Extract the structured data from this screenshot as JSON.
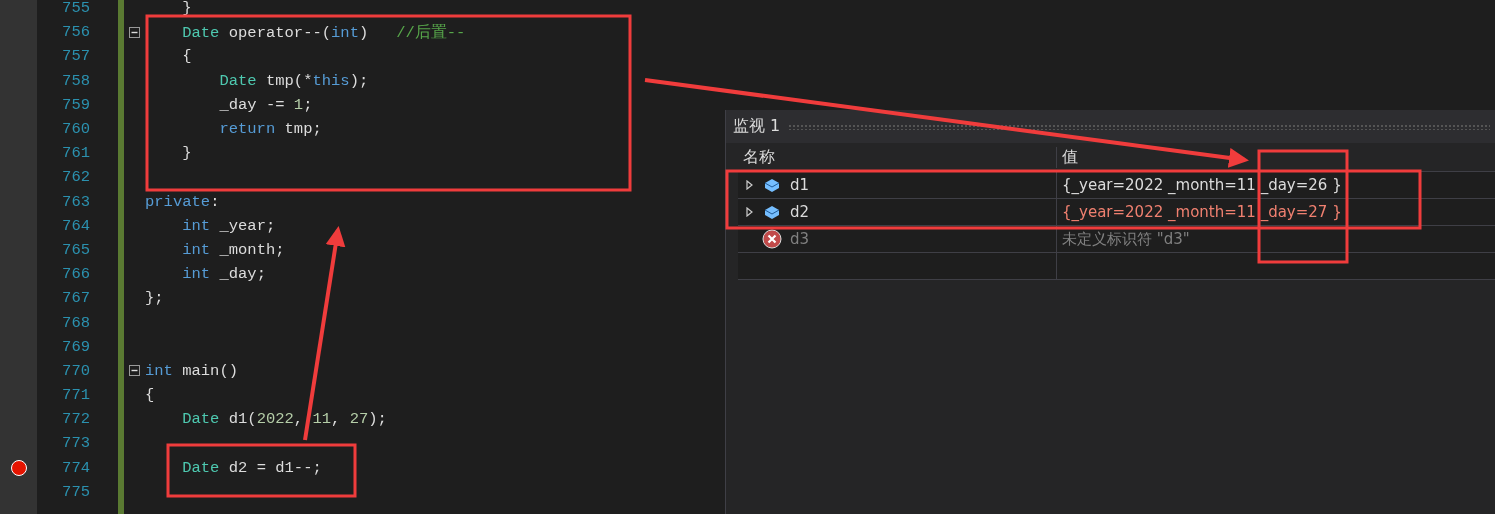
{
  "editor": {
    "lines": [
      {
        "number": "755",
        "breakpoint": false,
        "fold": false,
        "tokens": [
          {
            "kind": "plain",
            "text": "    }"
          }
        ]
      },
      {
        "number": "756",
        "breakpoint": false,
        "fold": true,
        "tokens": [
          {
            "kind": "type",
            "text": "    Date"
          },
          {
            "kind": "plain",
            "text": " operator--("
          },
          {
            "kind": "keyword",
            "text": "int"
          },
          {
            "kind": "plain",
            "text": ")   "
          },
          {
            "kind": "comment",
            "text": "//后置--"
          }
        ]
      },
      {
        "number": "757",
        "breakpoint": false,
        "fold": false,
        "tokens": [
          {
            "kind": "plain",
            "text": "    {"
          }
        ]
      },
      {
        "number": "758",
        "breakpoint": false,
        "fold": false,
        "tokens": [
          {
            "kind": "type",
            "text": "        Date"
          },
          {
            "kind": "plain",
            "text": " tmp(*"
          },
          {
            "kind": "keyword",
            "text": "this"
          },
          {
            "kind": "plain",
            "text": ");"
          }
        ]
      },
      {
        "number": "759",
        "breakpoint": false,
        "fold": false,
        "tokens": [
          {
            "kind": "plain",
            "text": "        _day -= "
          },
          {
            "kind": "number",
            "text": "1"
          },
          {
            "kind": "plain",
            "text": ";"
          }
        ]
      },
      {
        "number": "760",
        "breakpoint": false,
        "fold": false,
        "tokens": [
          {
            "kind": "keyword",
            "text": "        return"
          },
          {
            "kind": "plain",
            "text": " tmp;"
          }
        ]
      },
      {
        "number": "761",
        "breakpoint": false,
        "fold": false,
        "tokens": [
          {
            "kind": "plain",
            "text": "    }"
          }
        ]
      },
      {
        "number": "762",
        "breakpoint": false,
        "fold": false
      },
      {
        "number": "763",
        "breakpoint": false,
        "fold": false,
        "tokens": [
          {
            "kind": "keyword",
            "text": "private"
          },
          {
            "kind": "plain",
            "text": ":"
          }
        ]
      },
      {
        "number": "764",
        "breakpoint": false,
        "fold": false,
        "tokens": [
          {
            "kind": "keyword",
            "text": "    int"
          },
          {
            "kind": "plain",
            "text": " _year;"
          }
        ]
      },
      {
        "number": "765",
        "breakpoint": false,
        "fold": false,
        "tokens": [
          {
            "kind": "keyword",
            "text": "    int"
          },
          {
            "kind": "plain",
            "text": " _month;"
          }
        ]
      },
      {
        "number": "766",
        "breakpoint": false,
        "fold": false,
        "tokens": [
          {
            "kind": "keyword",
            "text": "    int"
          },
          {
            "kind": "plain",
            "text": " _day;"
          }
        ]
      },
      {
        "number": "767",
        "breakpoint": false,
        "fold": false,
        "tokens": [
          {
            "kind": "plain",
            "text": "};"
          }
        ]
      },
      {
        "number": "768",
        "breakpoint": false,
        "fold": false
      },
      {
        "number": "769",
        "breakpoint": false,
        "fold": false
      },
      {
        "number": "770",
        "breakpoint": false,
        "fold": true,
        "tokens": [
          {
            "kind": "keyword",
            "text": "int"
          },
          {
            "kind": "plain",
            "text": " main()"
          }
        ]
      },
      {
        "number": "771",
        "breakpoint": false,
        "fold": false,
        "tokens": [
          {
            "kind": "plain",
            "text": "{"
          }
        ]
      },
      {
        "number": "772",
        "breakpoint": false,
        "fold": false,
        "tokens": [
          {
            "kind": "type",
            "text": "    Date"
          },
          {
            "kind": "plain",
            "text": " d1("
          },
          {
            "kind": "number",
            "text": "2022"
          },
          {
            "kind": "plain",
            "text": ", "
          },
          {
            "kind": "number",
            "text": "11"
          },
          {
            "kind": "plain",
            "text": ", "
          },
          {
            "kind": "number",
            "text": "27"
          },
          {
            "kind": "plain",
            "text": ");"
          }
        ]
      },
      {
        "number": "773",
        "breakpoint": false,
        "fold": false
      },
      {
        "number": "774",
        "breakpoint": true,
        "fold": false,
        "tokens": [
          {
            "kind": "type",
            "text": "    Date"
          },
          {
            "kind": "plain",
            "text": " d2 = d1--;"
          }
        ]
      },
      {
        "number": "775",
        "breakpoint": false,
        "fold": false
      }
    ]
  },
  "watch": {
    "title": "监视 1",
    "columns": [
      "名称",
      "值"
    ],
    "rows": [
      {
        "kind": "object",
        "name": "d1",
        "value": "{_year=2022 _month=11 _day=26 }",
        "changed": false
      },
      {
        "kind": "object",
        "name": "d2",
        "value": "{_year=2022 _month=11 _day=27 }",
        "changed": true
      },
      {
        "kind": "error",
        "name": "d3",
        "value": "未定义标识符 \"d3\"",
        "changed": false
      }
    ]
  }
}
